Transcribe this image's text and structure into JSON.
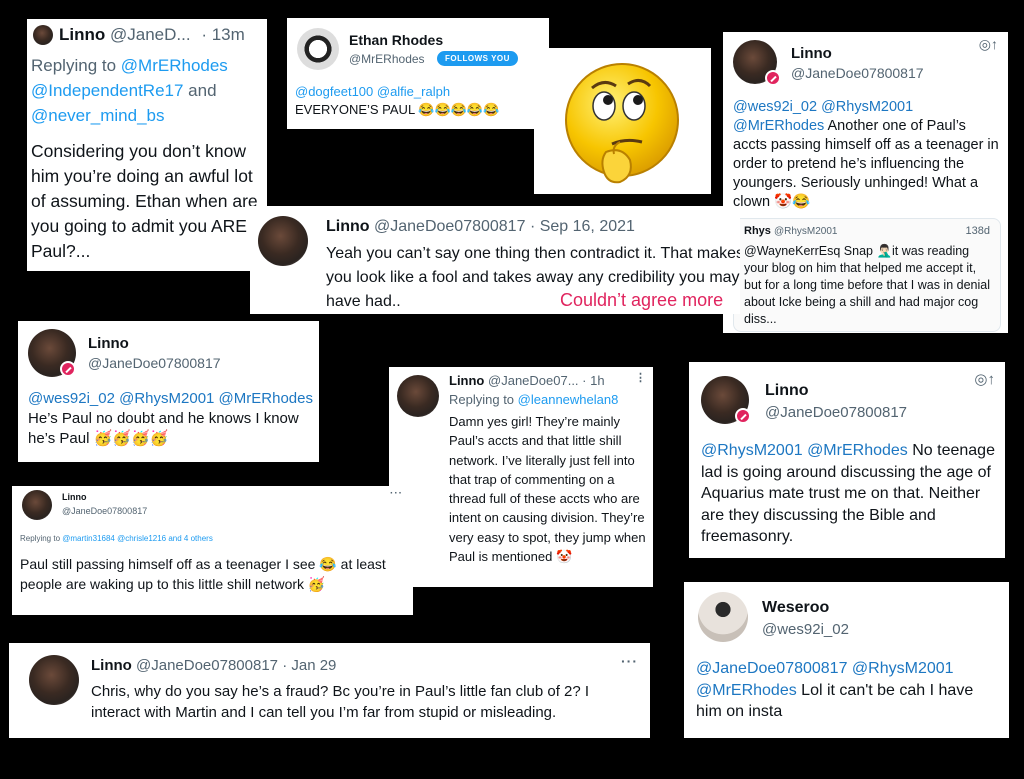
{
  "card1": {
    "name": "Linno",
    "handle": "@JaneD...",
    "time": "· 13m",
    "replying_prefix": "Replying to",
    "replying_users": "@MrERhodes @IndependentRe17",
    "replying_and": "and",
    "replying_last": "@never_mind_bs",
    "text": "Considering you don’t know him you’re doing an awful lot of assuming. Ethan when are you going to admit you ARE Paul?..."
  },
  "card2": {
    "name": "Ethan Rhodes",
    "handle": "@MrERhodes",
    "follows": "FOLLOWS YOU",
    "mentions": "@dogfeet100 @alfie_ralph",
    "text": "EVERYONE’S PAUL 😂😂😂😂😂"
  },
  "card3": {
    "name": "Linno",
    "handle": "@JaneDoe07800817",
    "mentions": "@wes92i_02 @RhysM2001 @MrERhodes",
    "text": "Another one of Paul’s accts passing himself off as a teenager in order to pretend he’s influencing the youngers. Seriously unhinged!  What a clown 🤡😂",
    "reply_name": "Rhys",
    "reply_handle": "@RhysM2001",
    "reply_time": "138d",
    "reply_mention": "@WayneKerrEsq",
    "reply_text": "Snap 🤦🏻‍♂️it was reading your blog on him that helped me accept it, but for a long time before that I was in denial about Icke being a shill and had major cog diss..."
  },
  "card4": {
    "name": "Linno",
    "handle": "@JaneDoe07800817",
    "time": "· Sep 16, 2021",
    "text": "Yeah you can’t say one thing then contradict it. That makes you look like a fool and takes away any credibility you may have had..",
    "overlay": "Couldn’t agree more"
  },
  "card5": {
    "name": "Linno",
    "handle": "@JaneDoe07800817",
    "mentions": "@wes92i_02 @RhysM2001 @MrERhodes",
    "text": "He’s Paul no doubt and he knows I know he’s Paul 🥳🥳🥳🥳"
  },
  "card6": {
    "name": "Linno",
    "handle": "@JaneDoe07...",
    "time": "· 1h",
    "replying_prefix": "Replying to",
    "replying_user": "@leannewhelan8",
    "text": "Damn yes girl! They’re mainly Paul’s accts and that little shill network. I’ve literally just fell into that trap of commenting on a thread full of these accts who are intent on causing division. They’re very easy to spot, they jump when Paul is mentioned 🤡"
  },
  "card7": {
    "name": "Linno",
    "handle": "@JaneDoe07800817",
    "mentions": "@RhysM2001 @MrERhodes",
    "text": "No teenage lad is going around discussing the age of Aquarius mate trust me on that. Neither are they discussing the Bible and freemasonry."
  },
  "card8": {
    "name": "Linno",
    "handle": "@JaneDoe07800817",
    "replying_prefix": "Replying to",
    "replying_users": "@martin31684 @chrisle1216",
    "replying_more": "and 4 others",
    "text": "Paul still passing himself off as a teenager I see 😂 at least people are waking up to this little shill network 🥳"
  },
  "card9": {
    "name": "Weseroo",
    "handle": "@wes92i_02",
    "mentions": "@JaneDoe07800817 @RhysM2001 @MrERhodes",
    "text": "Lol it can't be cah I have him on insta"
  },
  "card10": {
    "name": "Linno",
    "handle": "@JaneDoe07800817",
    "time": "· Jan 29",
    "text": "Chris, why do you say he’s a fraud? Bc you’re in Paul’s little fan club of 2? I interact with Martin and I can tell you I’m far from stupid or misleading."
  },
  "icons": {
    "reply_share": "◎↑",
    "more": "···"
  },
  "colors": {
    "background": "#000000",
    "link": "#1d9bf0",
    "overlay_red": "#e0245e",
    "emoji_face": "#f7c500"
  }
}
